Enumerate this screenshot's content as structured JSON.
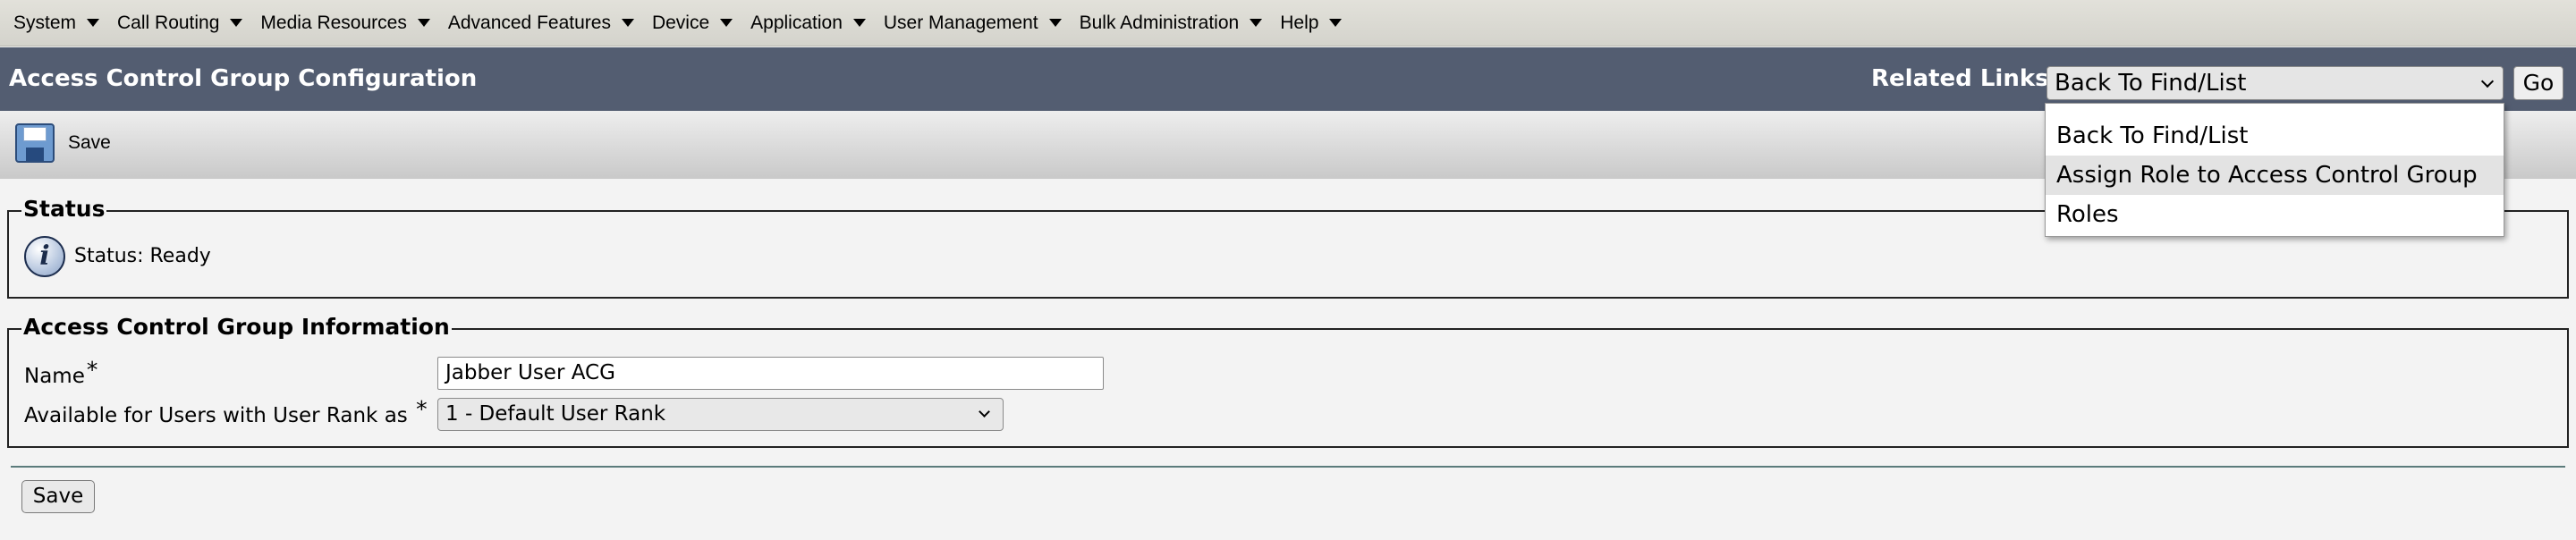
{
  "menubar": {
    "items": [
      {
        "label": "System"
      },
      {
        "label": "Call Routing"
      },
      {
        "label": "Media Resources"
      },
      {
        "label": "Advanced Features"
      },
      {
        "label": "Device"
      },
      {
        "label": "Application"
      },
      {
        "label": "User Management"
      },
      {
        "label": "Bulk Administration"
      },
      {
        "label": "Help"
      }
    ]
  },
  "header": {
    "title": "Access Control Group Configuration",
    "related_links_label": "Related Links:",
    "related_links_selected": "Back To Find/List",
    "go_label": "Go"
  },
  "toolbar": {
    "save_label": "Save",
    "save_icon": "floppy-disk-icon"
  },
  "status": {
    "legend": "Status",
    "icon": "info-icon",
    "text": "Status: Ready"
  },
  "group_info": {
    "legend": "Access Control Group Information",
    "name_label": "Name",
    "name_required": "*",
    "name_value": "Jabber User ACG",
    "rank_label": "Available for Users with User Rank as",
    "rank_required": "*",
    "rank_value": "1 - Default User Rank"
  },
  "footer": {
    "save_label": "Save"
  },
  "related_links_dropdown": {
    "options": [
      {
        "label": "Back To Find/List"
      },
      {
        "label": "Assign Role to Access Control Group"
      },
      {
        "label": "Roles"
      }
    ]
  },
  "colors": {
    "header_bg": "#535d71",
    "menubar_bg": "#d9d8d1",
    "page_bg": "#f3f3f3"
  }
}
